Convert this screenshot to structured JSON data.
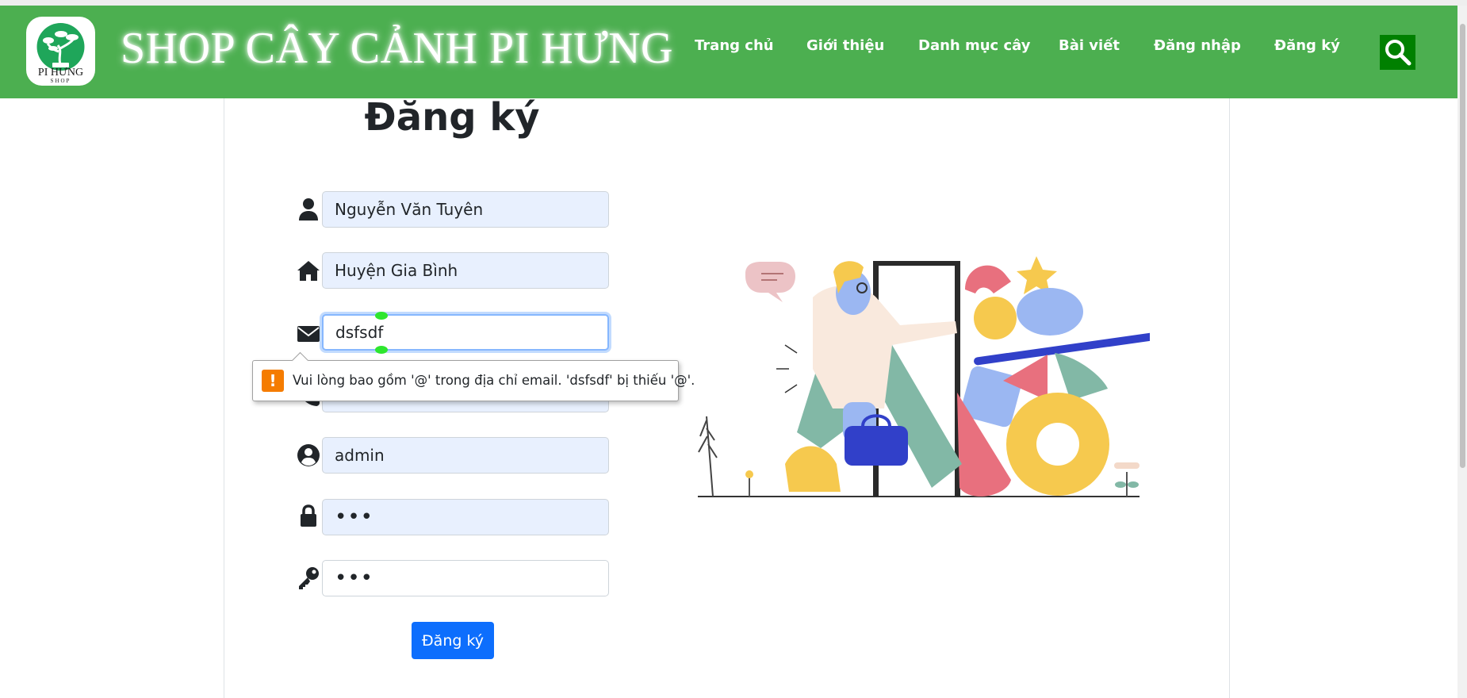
{
  "header": {
    "logo_text_main": "PI HƯNG",
    "logo_text_sub": "SHOP",
    "site_title": "SHOP CÂY CẢNH PI HƯNG",
    "nav": [
      {
        "label": "Trang chủ"
      },
      {
        "label": "Giới thiệu"
      },
      {
        "label": "Danh mục cây"
      },
      {
        "label": "Bài viết"
      },
      {
        "label": "Đăng nhập"
      },
      {
        "label": "Đăng ký"
      }
    ],
    "search_icon": "search-icon"
  },
  "form": {
    "heading": "Đăng ký",
    "fields": [
      {
        "icon": "user-icon",
        "value": "Nguyễn Văn Tuyên"
      },
      {
        "icon": "home-icon",
        "value": "Huyện Gia Bình"
      },
      {
        "icon": "envelope-icon",
        "value": "dsfsdf"
      },
      {
        "icon": "phone-icon",
        "value": ""
      },
      {
        "icon": "user-circle-icon",
        "value": "admin"
      },
      {
        "icon": "lock-icon",
        "value": "•••"
      },
      {
        "icon": "key-icon",
        "value": "•••"
      }
    ],
    "submit_label": "Đăng ký"
  },
  "validation": {
    "message": "Vui lòng bao gồm '@' trong địa chỉ email. 'dsfsdf' bị thiếu '@'.",
    "icon": "warning-icon"
  },
  "colors": {
    "navbar": "#4caf50",
    "search_button": "#008000",
    "submit_button": "#0d6efd",
    "autofill_field": "#e8f0fe",
    "warning": "#f57c00"
  }
}
